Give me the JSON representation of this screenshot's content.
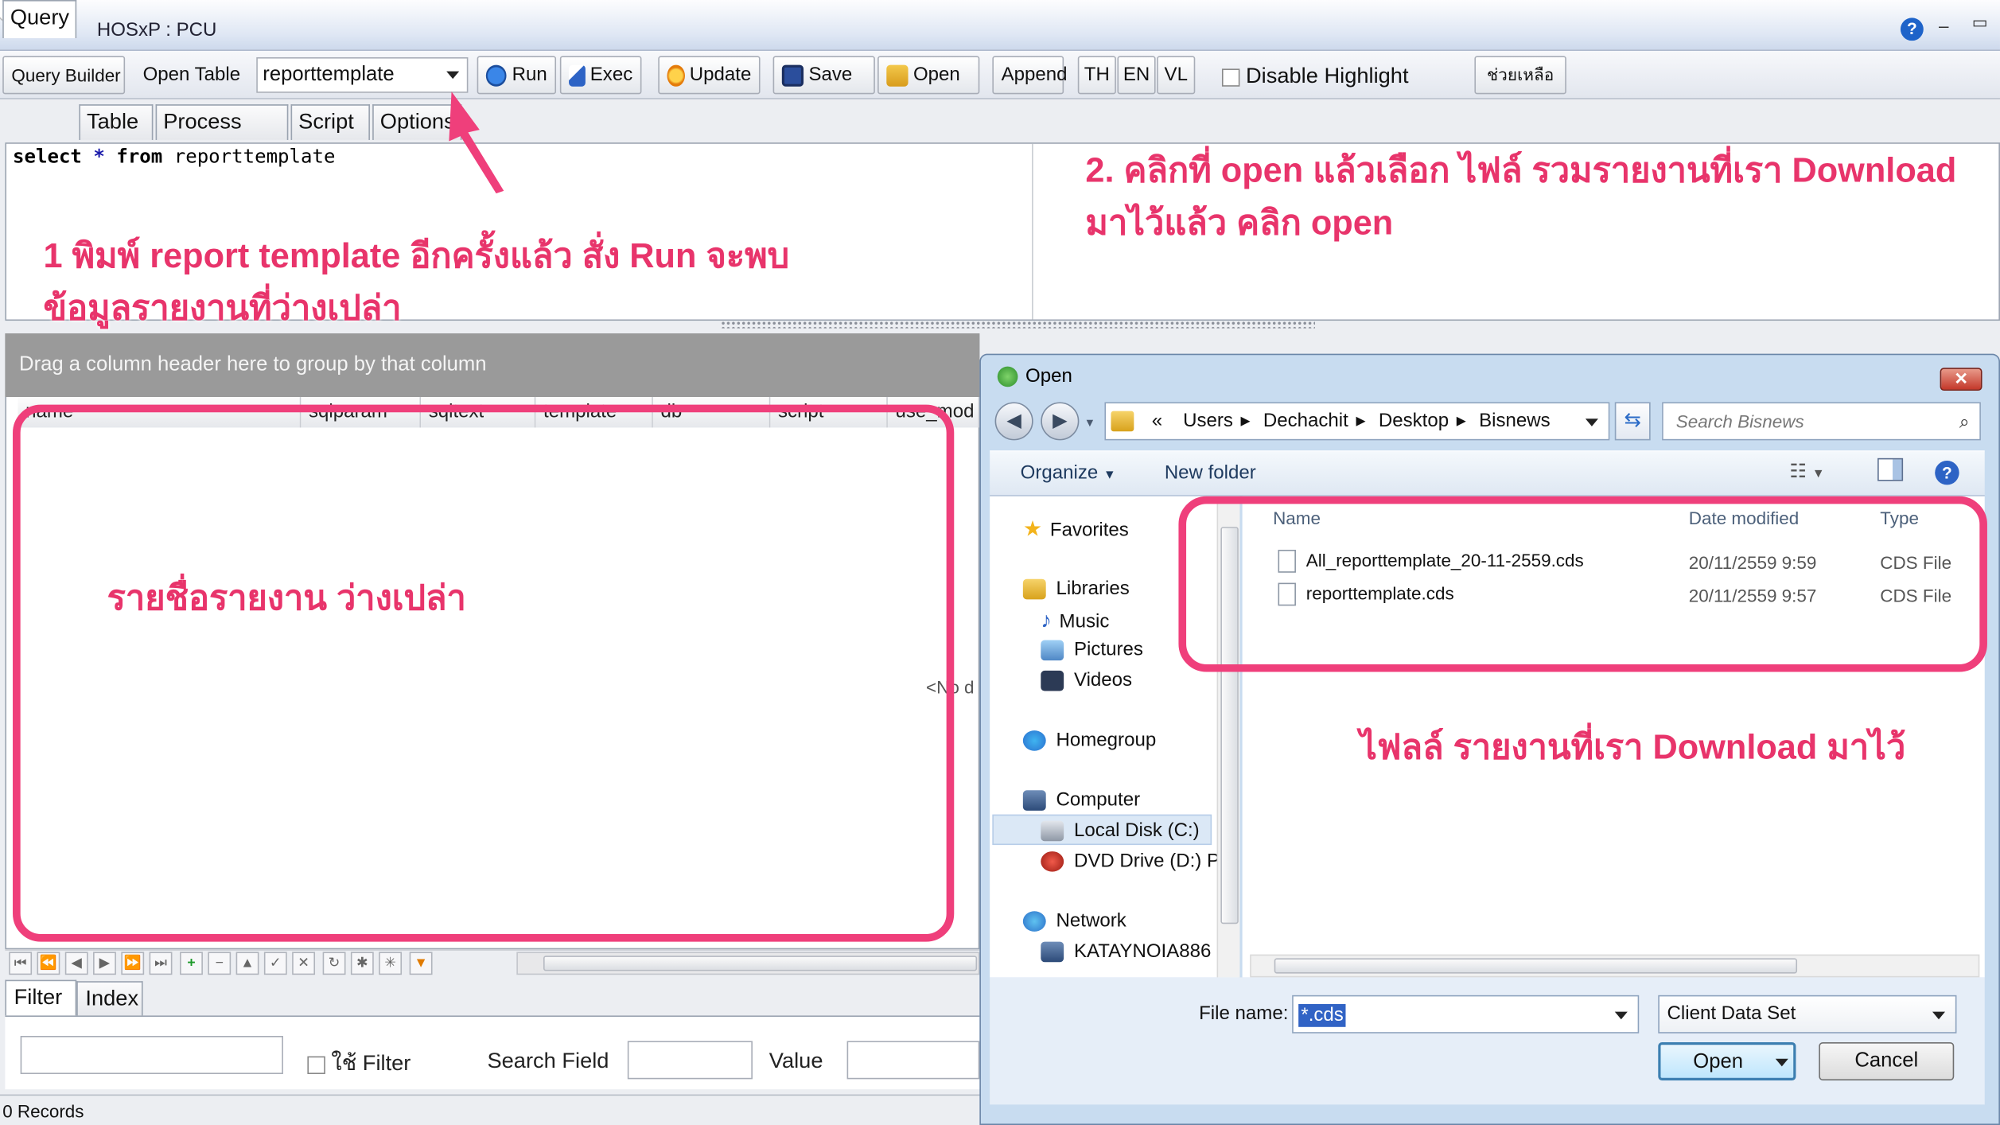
{
  "app": {
    "title": "HOSxP : PCU"
  },
  "toolbar": {
    "query_builder": "Query Builder",
    "open_table": "Open Table",
    "table_combo_value": "reporttemplate",
    "run": "Run",
    "exec": "Exec",
    "update": "Update",
    "save": "Save",
    "open": "Open",
    "append": "Append",
    "th": "TH",
    "en": "EN",
    "vl": "VL",
    "disable_highlight": "Disable Highlight",
    "help": "ช่วยเหลือ"
  },
  "tabs": [
    "Query",
    "Table",
    "Process List",
    "Script",
    "Options"
  ],
  "editor": {
    "kw_select": "select",
    "star": "*",
    "kw_from": "from",
    "table": "reporttemplate"
  },
  "annotations": {
    "step1_line1": "1  พิมพ์ report template อีกครั้งแล้ว สั่ง Run จะพบ",
    "step1_line2": "ข้อมูลรายงานที่ว่างเปล่า",
    "step2_line1": "2. คลิกที่ open แล้วเลือก ไฟล์  รวมรายงานที่เรา Download",
    "step2_line2": "มาไว้แล้ว คลิก open",
    "empty_list": "รายชื่อรายงาน ว่างเปล่า",
    "downloaded_files": "ไฟลล์ รายงานที่เรา Download มาไว้"
  },
  "grid": {
    "group_panel": "Drag a column header here to group by that column",
    "columns": [
      "name",
      "sqlparam",
      "sqltext",
      "template",
      "db",
      "script",
      "use_mod"
    ],
    "no_data": "<No d"
  },
  "bottom_tabs": [
    "Filter",
    "Index"
  ],
  "filter": {
    "use_filter": "ใช้ Filter",
    "search_field": "Search Field",
    "value": "Value"
  },
  "status": {
    "records": "0 Records"
  },
  "dialog": {
    "title": "Open",
    "breadcrumb": [
      "«",
      "Users",
      "Dechachit",
      "Desktop",
      "Bisnews"
    ],
    "search_placeholder": "Search Bisnews",
    "organize": "Organize",
    "new_folder": "New folder",
    "nav": {
      "favorites": "Favorites",
      "libraries": "Libraries",
      "music": "Music",
      "pictures": "Pictures",
      "videos": "Videos",
      "homegroup": "Homegroup",
      "computer": "Computer",
      "local_disk": "Local Disk (C:)",
      "dvd_drive": "DVD Drive (D:) Pa",
      "network": "Network",
      "katay": "KATAYNOIA886"
    },
    "columns": {
      "name": "Name",
      "date": "Date modified",
      "type": "Type"
    },
    "files": [
      {
        "name": "All_reporttemplate_20-11-2559.cds",
        "date": "20/11/2559 9:59",
        "type": "CDS File"
      },
      {
        "name": "reporttemplate.cds",
        "date": "20/11/2559 9:57",
        "type": "CDS File"
      }
    ],
    "file_name_label": "File name:",
    "file_name_value": "*.cds",
    "file_type": "Client Data Set",
    "open_button": "Open",
    "cancel_button": "Cancel"
  },
  "colors": {
    "annotation": "#e8346b",
    "highlight_box": "#ef3f7b"
  }
}
